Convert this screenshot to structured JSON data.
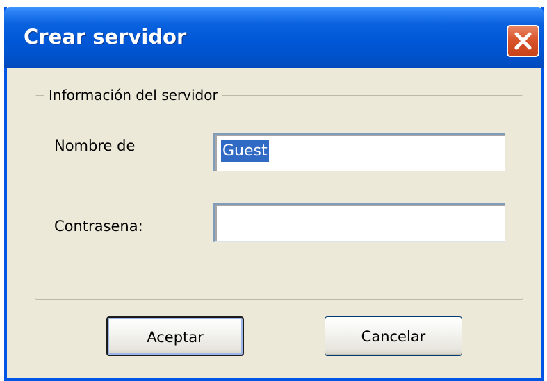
{
  "window": {
    "title": "Crear servidor",
    "close_icon": "close-icon"
  },
  "group": {
    "legend": "Información del servidor"
  },
  "form": {
    "username_label": "Nombre de",
    "username_value": "Guest",
    "password_label": "Contrasena:",
    "password_value": ""
  },
  "buttons": {
    "accept_label": "Aceptar",
    "cancel_label": "Cancelar"
  },
  "colors": {
    "titlebar": "#0058D8",
    "dialog_background": "#ECE9D8",
    "close_button": "#D9542B",
    "selection": "#316AC5"
  }
}
